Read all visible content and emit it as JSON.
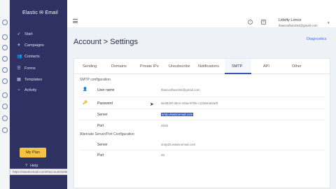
{
  "sidebar": {
    "brand": "Elastic ✉ Email",
    "items": [
      {
        "label": "Start",
        "icon": "rocket-icon"
      },
      {
        "label": "Campaigns",
        "icon": "paper-plane-icon"
      },
      {
        "label": "Contacts",
        "icon": "users-icon"
      },
      {
        "label": "Forms",
        "icon": "form-icon"
      },
      {
        "label": "Templates",
        "icon": "template-icon"
      },
      {
        "label": "Activity",
        "icon": "activity-icon"
      }
    ],
    "plan_label": "My Plan",
    "help_label": "Help",
    "status_url": "https://elasticemail.com/#/account/settings/smtp"
  },
  "topbar": {
    "user_name": "Lidelty Lonce",
    "user_email": "ifawoodhan254@gmail.com"
  },
  "page": {
    "title": "Account > Settings",
    "diagnostics_label": "Diagnostics"
  },
  "tabs": [
    "Sending",
    "Domains",
    "Private IPs",
    "Unsubscribe",
    "Notifications",
    "SMTP",
    "API",
    "Other"
  ],
  "active_tab": "SMTP",
  "smtp": {
    "section_title": "SMTP configuration",
    "username_label": "User name",
    "username_value": "ifawoodhan254@gmail.com",
    "password_label": "Password",
    "password_value": "9e2B29f-3bce-425a-979b-c1226ea62a0f",
    "server_label": "Server",
    "server_value": "smtp.elasticemail.com",
    "port_label": "Port",
    "port_value": "2525"
  },
  "alternate": {
    "section_title": "Alternate Server/Port Configuration",
    "server_label": "Server",
    "server_value": "smtp25.elasticemail.com",
    "port_label": "Port",
    "port_value": "25"
  },
  "colors": {
    "sidebar_bg": "#2e3162",
    "plan_button": "#f5c343",
    "accent": "#3b4fb8",
    "content_bg": "#eef1f6"
  }
}
